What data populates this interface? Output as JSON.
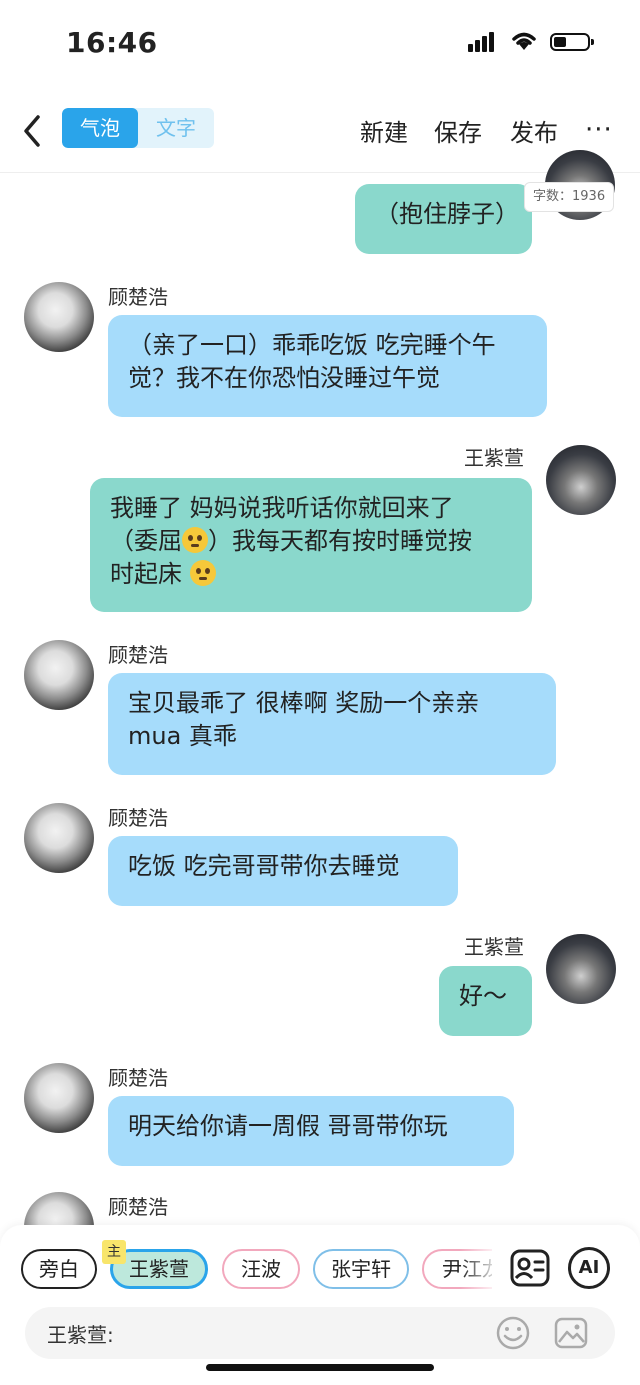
{
  "status": {
    "time": "16:46"
  },
  "nav": {
    "tab_bubble": "气泡",
    "tab_text": "文字",
    "new_label": "新建",
    "save_label": "保存",
    "publish_label": "发布",
    "more_label": "···"
  },
  "word_count": "字数：1936",
  "messages": [
    {
      "side": "right",
      "name": "",
      "text": "（抱住脖子）"
    },
    {
      "side": "left",
      "name": "顾楚浩",
      "text_lines": [
        "（亲了一口）乖乖吃饭 吃完睡个午",
        "觉？我不在你恐怕没睡过午觉"
      ]
    },
    {
      "side": "right",
      "name": "王紫萱",
      "text_lines": [
        "我睡了 妈妈说我听话你就回来了",
        "（委屈",
        "）我每天都有按时睡觉按",
        "时起床 "
      ],
      "emoji": "pleading-face-emoji"
    },
    {
      "side": "left",
      "name": "顾楚浩",
      "text_lines": [
        "宝贝最乖了 很棒啊 奖励一个亲亲",
        "mua 真乖"
      ]
    },
    {
      "side": "left",
      "name": "顾楚浩",
      "text": "吃饭 吃完哥哥带你去睡觉"
    },
    {
      "side": "right",
      "name": "王紫萱",
      "text": "好～"
    },
    {
      "side": "left",
      "name": "顾楚浩",
      "text": "明天给你请一周假 哥哥带你玩"
    },
    {
      "side": "left",
      "name": "顾楚浩",
      "text": ""
    }
  ],
  "characters": {
    "aside": "旁白",
    "selected": "王紫萱",
    "main_badge": "主",
    "others": [
      "汪波",
      "张宇轩",
      "尹江龙"
    ]
  },
  "input": {
    "label": "王紫萱:"
  },
  "toolbar": {
    "ai_label": "AI"
  },
  "colors": {
    "accent": "#2aa4ea",
    "bubble_left": "#a6dcfb",
    "bubble_right": "#8ad8cc"
  }
}
